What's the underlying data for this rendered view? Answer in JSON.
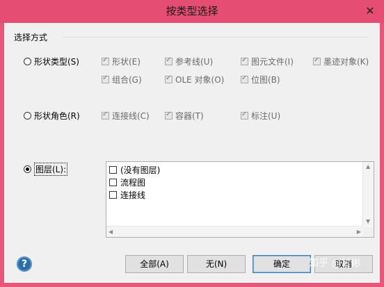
{
  "window": {
    "title": "按类型选择",
    "close_glyph": "✕"
  },
  "group_label": "选择方式",
  "options": {
    "shape_type": {
      "label": "形状类型(S)",
      "selected": false,
      "checkboxes": [
        "形状(E)",
        "参考线(U)",
        "图元文件(I)",
        "墨迹对象(K)",
        "组合(G)",
        "OLE 对象(O)",
        "位图(B)"
      ]
    },
    "shape_role": {
      "label": "形状角色(R)",
      "selected": false,
      "checkboxes": [
        "连接线(C)",
        "容器(T)",
        "标注(U)"
      ]
    },
    "layer": {
      "label": "图层(L):",
      "selected": true
    }
  },
  "layer_list": {
    "items": [
      "(没有图层)",
      "流程图",
      "连接线"
    ]
  },
  "buttons": {
    "all": "全部(A)",
    "none": "无(N)",
    "ok": "确定",
    "cancel": "取消"
  },
  "help_icon": "question-mark-icon",
  "watermark": "知乎 @甘彬",
  "colors": {
    "titlebar": "#e54d72",
    "accent": "#3c7fb1"
  }
}
